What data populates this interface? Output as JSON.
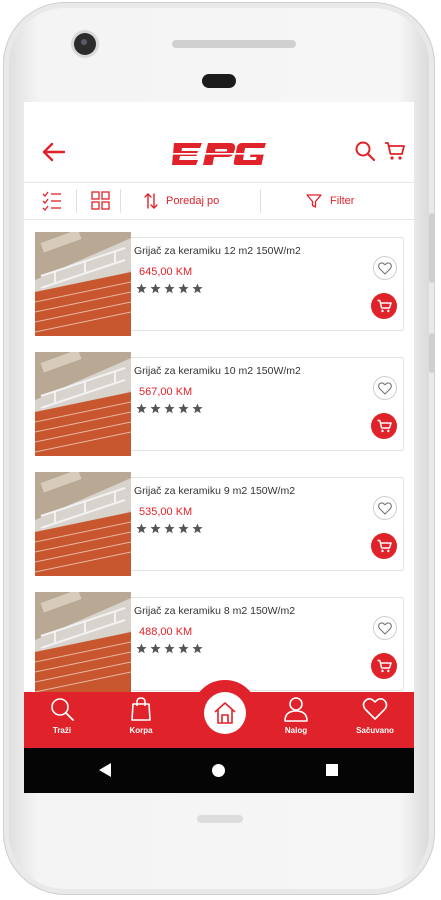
{
  "app": {
    "brand": "EPG"
  },
  "toolbar": {
    "sort_label": "Poredaj po",
    "filter_label": "Filter"
  },
  "products": [
    {
      "name": "Grijač za keramiku 12 m2 150W/m2",
      "price": "645,00 KM",
      "rating": 0,
      "max_rating": 5
    },
    {
      "name": "Grijač za keramiku 10 m2 150W/m2",
      "price": "567,00 KM",
      "rating": 0,
      "max_rating": 5
    },
    {
      "name": "Grijač za keramiku 9 m2 150W/m2",
      "price": "535,00 KM",
      "rating": 0,
      "max_rating": 5
    },
    {
      "name": "Grijač za keramiku 8 m2 150W/m2",
      "price": "488,00 KM",
      "rating": 0,
      "max_rating": 5
    }
  ],
  "bottom_nav": {
    "items": [
      {
        "label": "Traži",
        "icon": "search-icon"
      },
      {
        "label": "Korpa",
        "icon": "bag-icon"
      },
      {
        "label": "",
        "icon": "home-icon"
      },
      {
        "label": "Nalog",
        "icon": "user-icon"
      },
      {
        "label": "Sačuvano",
        "icon": "heart-icon"
      }
    ]
  },
  "colors": {
    "accent": "#e0232a",
    "star": "#555555",
    "system_bar": "#050505"
  }
}
